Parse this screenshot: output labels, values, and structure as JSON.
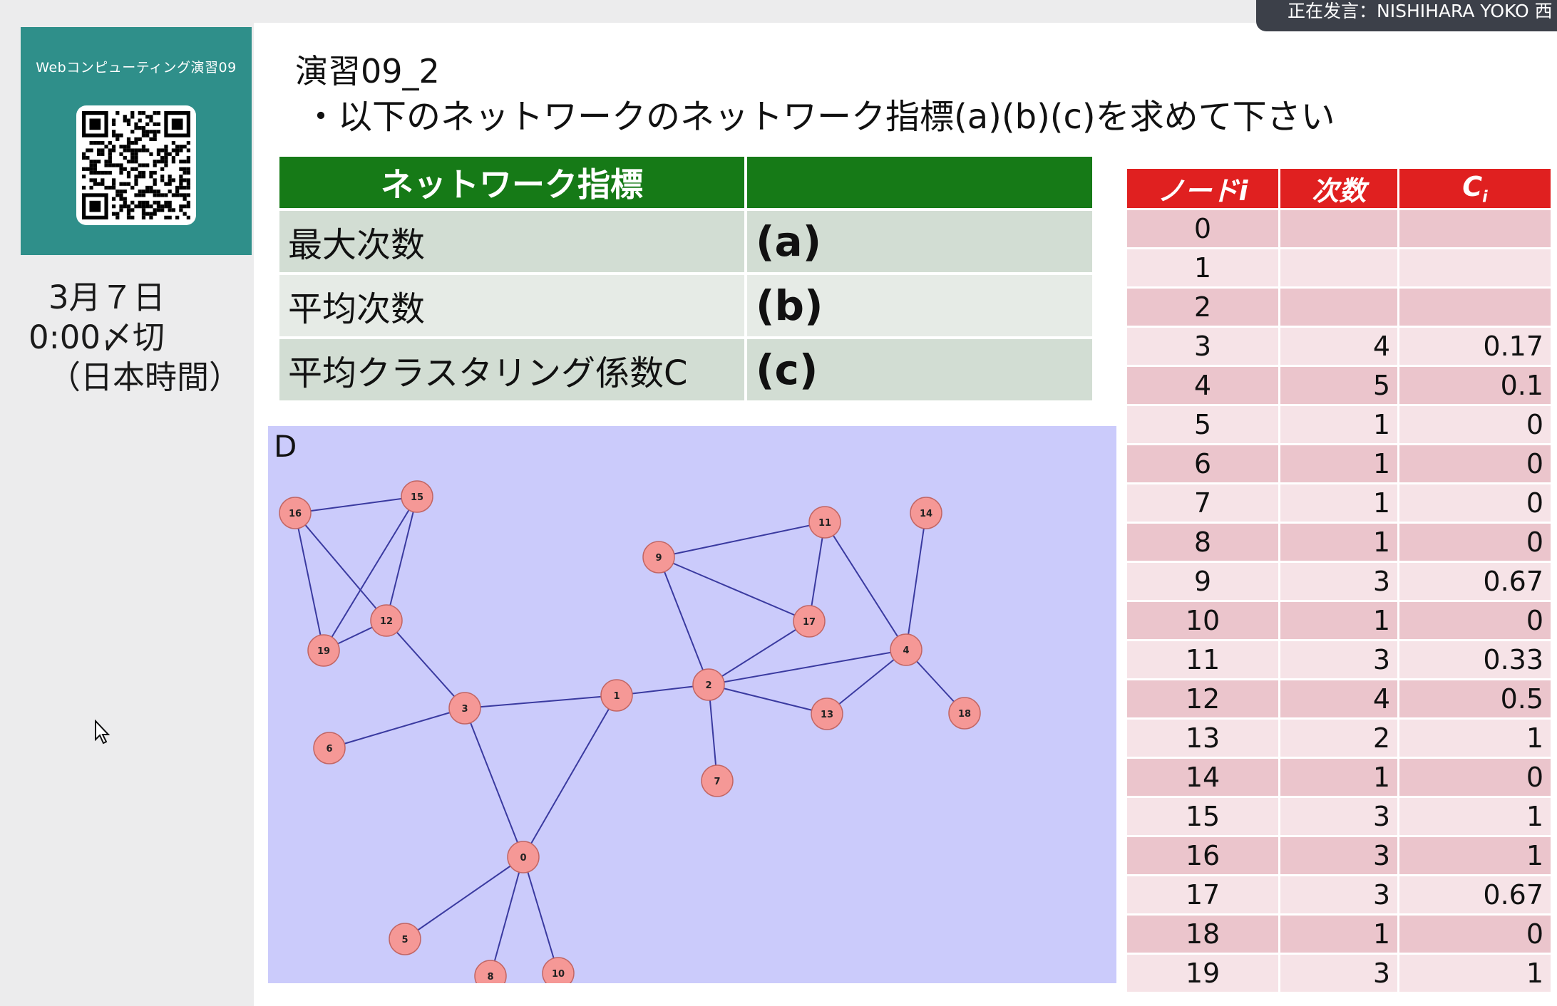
{
  "sidebar": {
    "course_title": "Webコンピューティング演習09",
    "deadline": [
      "3月７日",
      "0:00〆切",
      "（日本時間）"
    ]
  },
  "slide": {
    "title": "演習09_2",
    "subtitle": "・以下のネットワークのネットワーク指標(a)(b)(c)を求めて下さい",
    "index_table": {
      "headers": [
        "ネットワーク指標",
        ""
      ],
      "rows": [
        {
          "name": "最大次数",
          "value": "(a)"
        },
        {
          "name": "平均次数",
          "value": "(b)"
        },
        {
          "name": "平均クラスタリング係数C",
          "value": "(c)"
        }
      ]
    },
    "network": {
      "label": "D",
      "nodes": [
        "0",
        "1",
        "2",
        "3",
        "4",
        "5",
        "6",
        "7",
        "8",
        "9",
        "10",
        "11",
        "12",
        "13",
        "14",
        "15",
        "16",
        "17",
        "18",
        "19"
      ],
      "edges": [
        [
          "16",
          "15"
        ],
        [
          "16",
          "12"
        ],
        [
          "16",
          "19"
        ],
        [
          "15",
          "12"
        ],
        [
          "15",
          "19"
        ],
        [
          "19",
          "12"
        ],
        [
          "12",
          "3"
        ],
        [
          "3",
          "6"
        ],
        [
          "3",
          "1"
        ],
        [
          "3",
          "0"
        ],
        [
          "1",
          "0"
        ],
        [
          "1",
          "2"
        ],
        [
          "0",
          "5"
        ],
        [
          "0",
          "8"
        ],
        [
          "0",
          "10"
        ],
        [
          "2",
          "7"
        ],
        [
          "2",
          "13"
        ],
        [
          "2",
          "4"
        ],
        [
          "2",
          "17"
        ],
        [
          "2",
          "9"
        ],
        [
          "9",
          "11"
        ],
        [
          "9",
          "17"
        ],
        [
          "11",
          "17"
        ],
        [
          "11",
          "4"
        ],
        [
          "14",
          "4"
        ],
        [
          "4",
          "13"
        ],
        [
          "4",
          "18"
        ]
      ],
      "node_color": "#f59896",
      "edge_color": "#3a3aa0",
      "background": "#cbcbfb"
    },
    "degree_table": {
      "headers": [
        "ノードi",
        "次数",
        "Ci"
      ],
      "header_color": "#e02020",
      "rows": [
        [
          "0",
          "",
          ""
        ],
        [
          "1",
          "",
          ""
        ],
        [
          "2",
          "",
          ""
        ],
        [
          "3",
          "4",
          "0.17"
        ],
        [
          "4",
          "5",
          "0.1"
        ],
        [
          "5",
          "1",
          "0"
        ],
        [
          "6",
          "1",
          "0"
        ],
        [
          "7",
          "1",
          "0"
        ],
        [
          "8",
          "1",
          "0"
        ],
        [
          "9",
          "3",
          "0.67"
        ],
        [
          "10",
          "1",
          "0"
        ],
        [
          "11",
          "3",
          "0.33"
        ],
        [
          "12",
          "4",
          "0.5"
        ],
        [
          "13",
          "2",
          "1"
        ],
        [
          "14",
          "1",
          "0"
        ],
        [
          "15",
          "3",
          "1"
        ],
        [
          "16",
          "3",
          "1"
        ],
        [
          "17",
          "3",
          "0.67"
        ],
        [
          "18",
          "1",
          "0"
        ],
        [
          "19",
          "3",
          "1"
        ]
      ]
    }
  },
  "meeting": {
    "speaker_text": "正在发言：NISHIHARA YOKO 西"
  }
}
